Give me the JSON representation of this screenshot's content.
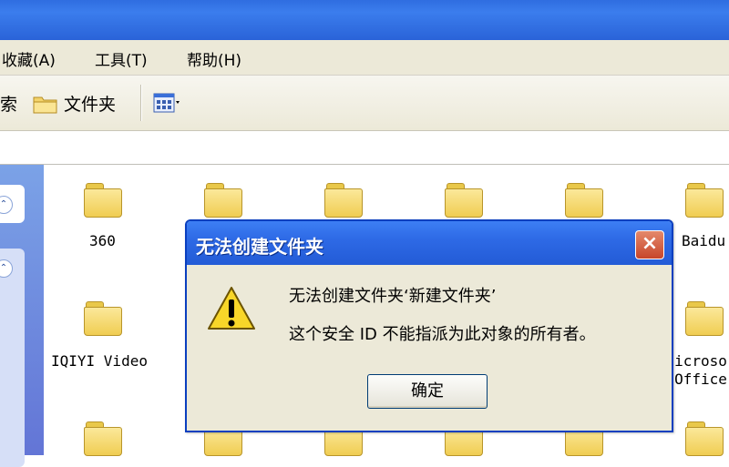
{
  "menubar": {
    "favorites": "收藏(A)",
    "tools": "工具(T)",
    "help": "帮助(H)"
  },
  "toolbar": {
    "search_partial": "索",
    "folders": "文件夹"
  },
  "folders": [
    {
      "name": "360"
    },
    {
      "name": ""
    },
    {
      "name": ""
    },
    {
      "name": ""
    },
    {
      "name": ""
    },
    {
      "name": "Baidu"
    },
    {
      "name": "IQIYI Video"
    },
    {
      "name": "icroso Office"
    }
  ],
  "dialog": {
    "title": "无法创建文件夹",
    "line1": "无法创建文件夹‘新建文件夹’",
    "line2": "这个安全 ID 不能指派为此对象的所有者。",
    "ok": "确定",
    "close": "×"
  },
  "colors": {
    "title_blue": "#2a63d8",
    "dialog_bg": "#ece9d8",
    "folder_yellow": "#f0cd52",
    "close_red": "#c7452a"
  },
  "icons": [
    "folder-icon",
    "view-icon",
    "warning-icon",
    "close-icon",
    "chevron-up-icon"
  ]
}
